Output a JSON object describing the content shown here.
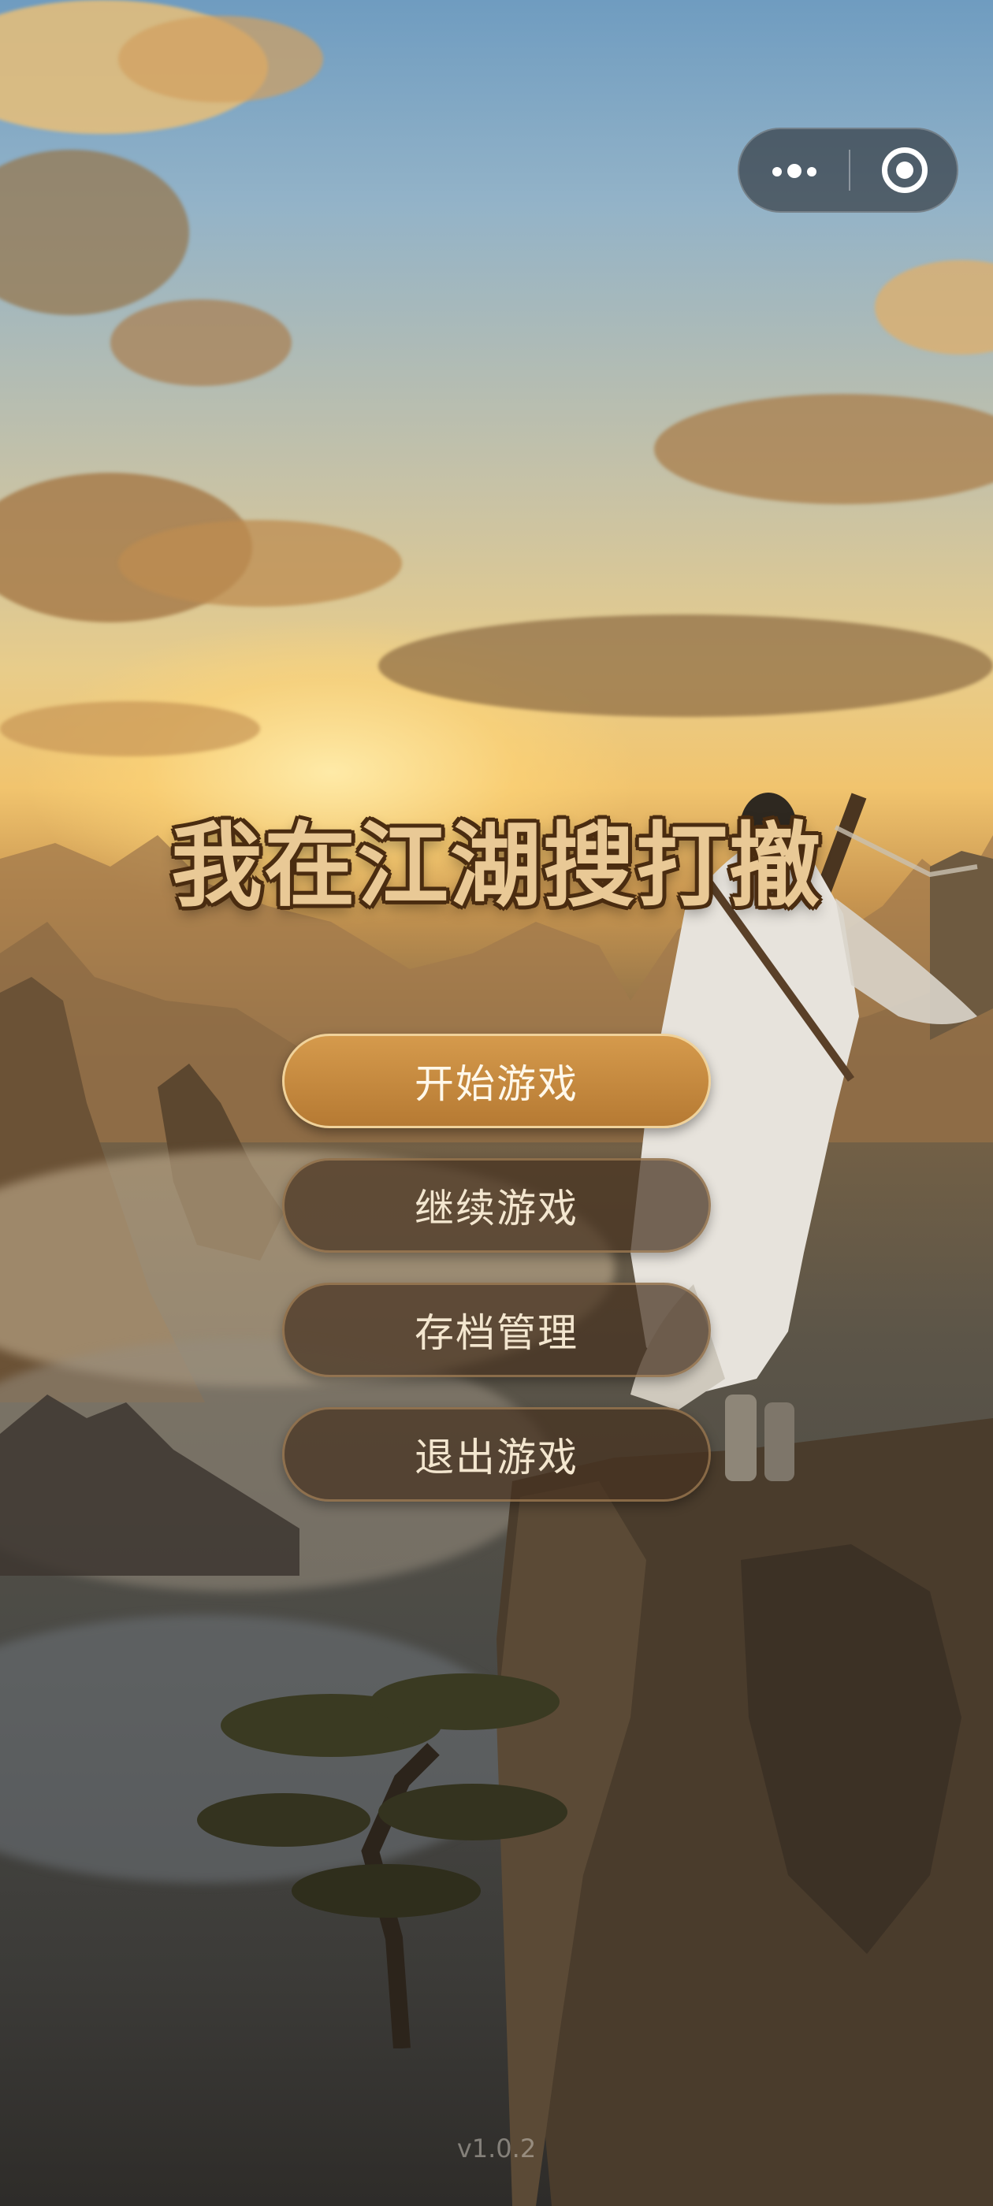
{
  "game": {
    "title": "我在江湖搜打撤",
    "version": "v1.0.2"
  },
  "menu": {
    "start": "开始游戏",
    "continue": "继续游戏",
    "saves": "存档管理",
    "exit": "退出游戏"
  },
  "capsule": {
    "more_icon": "more-dots-icon",
    "close_icon": "target-circle-icon"
  },
  "colors": {
    "primary_button": "#c68a3e",
    "secondary_button": "#46321f",
    "title_fill": "#e9c996",
    "title_outline": "#4a2c10"
  }
}
